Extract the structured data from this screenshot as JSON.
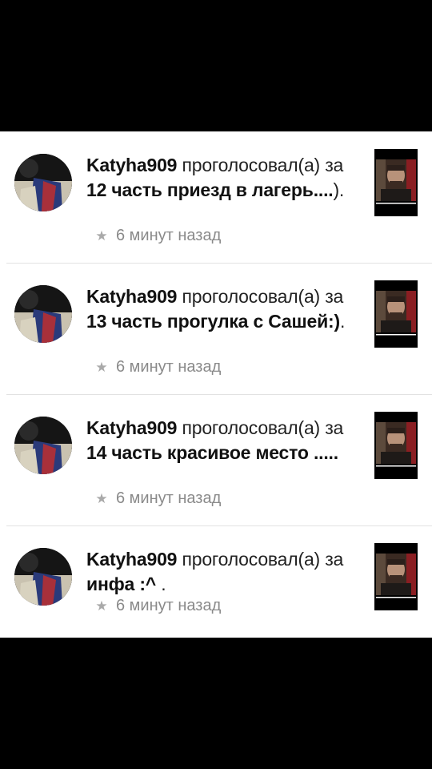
{
  "feed": {
    "items": [
      {
        "user": "Katyha909",
        "action": "проголосовал(а)",
        "preposition": "за",
        "part_title": "12 часть приезд в лагерь....",
        "suffix": ").",
        "time": "6 минут назад",
        "time_icon": "star-icon",
        "thumbnail": "story-cover-thumbnail"
      },
      {
        "user": "Katyha909",
        "action": "проголосовал(а)",
        "preposition": "за",
        "part_title": "13 часть прогулка с Сашей:)",
        "suffix": ".",
        "time": "6 минут назад",
        "time_icon": "star-icon",
        "thumbnail": "story-cover-thumbnail"
      },
      {
        "user": "Katyha909",
        "action": "проголосовал(а)",
        "preposition": "за",
        "part_title": "14 часть красивое место .....",
        "suffix": "",
        "time": "6 минут назад",
        "time_icon": "star-icon",
        "thumbnail": "story-cover-thumbnail"
      },
      {
        "user": "Katyha909",
        "action": "проголосовал(а)",
        "preposition": "за",
        "part_title": "инфа :^",
        "suffix": " .",
        "time": "6 минут назад",
        "time_icon": "star-icon",
        "thumbnail": "story-cover-thumbnail"
      }
    ]
  },
  "colors": {
    "background": "#000000",
    "card": "#ffffff",
    "text": "#1a1a1a",
    "muted": "#8a8a8a",
    "divider": "#e2e2e2"
  }
}
